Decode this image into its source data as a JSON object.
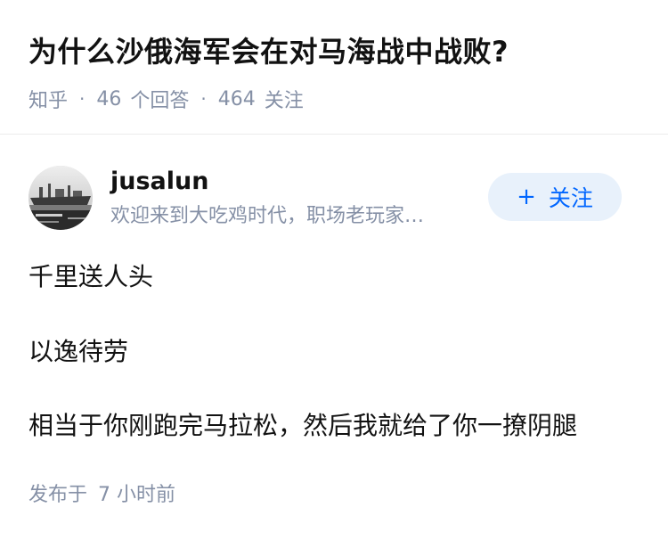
{
  "question": {
    "title": "为什么沙俄海军会在对马海战中战败?",
    "source": "知乎",
    "answer_count": "46",
    "answer_label": "个回答",
    "follower_count": "464",
    "follower_label": "关注"
  },
  "author": {
    "name": "jusalun",
    "bio": "欢迎来到大吃鸡时代，职场老玩家…",
    "avatar_icon": "warship-avatar",
    "follow_button": {
      "plus": "+",
      "label": "关注"
    }
  },
  "answer": {
    "paragraphs": [
      "千里送人头",
      "以逸待劳",
      "相当于你刚跑完马拉松，然后我就给了你一撩阴腿"
    ],
    "time_prefix": "发布于",
    "time_value": "7 小时前"
  },
  "colors": {
    "text_primary": "#121212",
    "text_secondary": "#8590a6",
    "brand_blue": "#0066ff",
    "follow_bg": "#e8f1fb",
    "divider": "#ebebeb"
  }
}
